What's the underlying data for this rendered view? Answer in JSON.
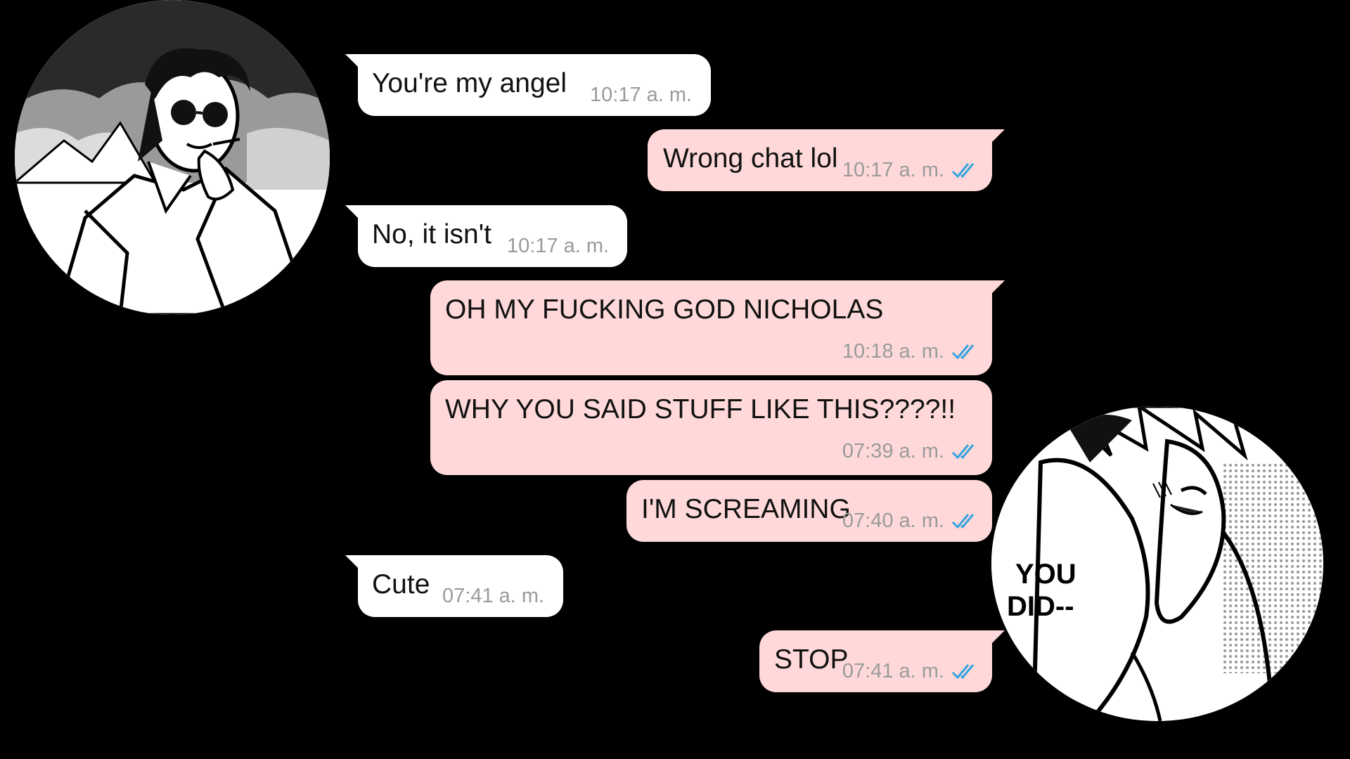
{
  "colors": {
    "background": "#000000",
    "incoming_bubble": "#ffffff",
    "outgoing_bubble": "#ffd9d9",
    "timestamp": "#9a9a9a",
    "read_ticks": "#34a3e0"
  },
  "avatars": {
    "left": {
      "icon": "manga-man-sunglasses-avatar"
    },
    "right": {
      "icon": "manga-couple-avatar",
      "caption_line1": "YOU",
      "caption_line2": "DID--"
    }
  },
  "messages": [
    {
      "direction": "incoming",
      "text": "You're my angel",
      "time": "10:17 a. m."
    },
    {
      "direction": "outgoing",
      "text": "Wrong chat lol",
      "time": "10:17 a. m.",
      "status": "read"
    },
    {
      "direction": "incoming",
      "text": "No, it isn't",
      "time": "10:17 a. m."
    },
    {
      "direction": "outgoing",
      "text": "OH MY FUCKING GOD NICHOLAS",
      "time": "10:18 a. m.",
      "status": "read"
    },
    {
      "direction": "outgoing",
      "text": "WHY YOU SAID STUFF LIKE THIS????!!",
      "time": "07:39 a. m.",
      "status": "read"
    },
    {
      "direction": "outgoing",
      "text": "I'M SCREAMING",
      "time": "07:40 a. m.",
      "status": "read"
    },
    {
      "direction": "incoming",
      "text": "Cute",
      "time": "07:41 a. m."
    },
    {
      "direction": "outgoing",
      "text": "STOP",
      "time": "07:41 a. m.",
      "status": "read"
    }
  ]
}
